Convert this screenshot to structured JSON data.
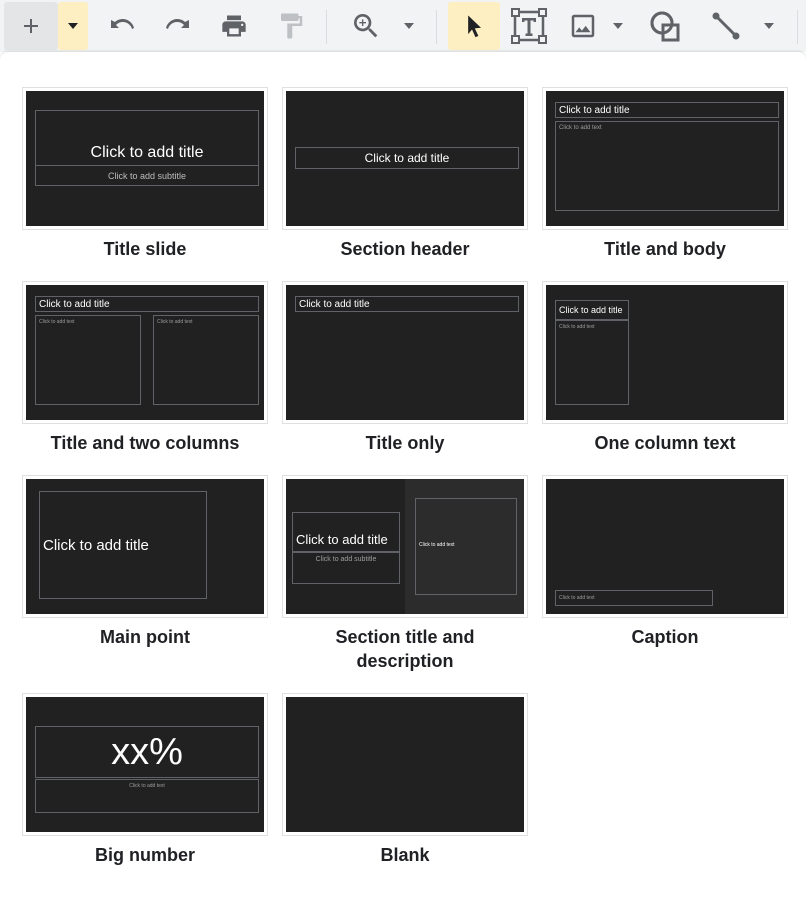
{
  "toolbar": {
    "icons": [
      "plus-icon",
      "dropdown-arrow-icon",
      "undo-icon",
      "redo-icon",
      "print-icon",
      "paint-format-icon",
      "zoom-in-icon",
      "zoom-dropdown-icon",
      "cursor-icon",
      "text-box-icon",
      "image-icon",
      "image-dropdown-icon",
      "shape-icon",
      "line-icon",
      "line-dropdown-icon"
    ],
    "accent": "#feefc3"
  },
  "layouts": [
    {
      "name": "Title slide",
      "title": "Click to add title",
      "subtitle": "Click to add subtitle"
    },
    {
      "name": "Section header",
      "title": "Click to add title"
    },
    {
      "name": "Title and body",
      "title": "Click to add title",
      "body": "Click to add text"
    },
    {
      "name": "Title and two columns",
      "title": "Click to add title",
      "col1": "Click to add text",
      "col2": "Click to add text"
    },
    {
      "name": "Title only",
      "title": "Click to add title"
    },
    {
      "name": "One column text",
      "title": "Click to add title",
      "body": "Click to add text"
    },
    {
      "name": "Main point",
      "title": "Click to add title"
    },
    {
      "name": "Section title and description",
      "title": "Click to add title",
      "subtitle": "Click to add subtitle",
      "body": "Click to add text"
    },
    {
      "name": "Caption",
      "body": "Click to add text"
    },
    {
      "name": "Big number",
      "title": "xx%",
      "body": "Click to add text"
    },
    {
      "name": "Blank"
    }
  ],
  "colors": {
    "thumbnail_bg": "#212121",
    "placeholder_border": "#5f6368",
    "label_text": "#202124"
  }
}
